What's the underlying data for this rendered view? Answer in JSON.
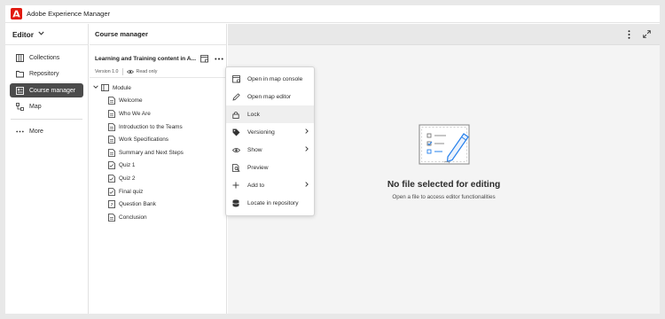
{
  "app": {
    "title": "Adobe Experience Manager"
  },
  "leftnav": {
    "header": "Editor",
    "items": [
      {
        "label": "Collections",
        "icon": "collections-icon"
      },
      {
        "label": "Repository",
        "icon": "repository-icon"
      },
      {
        "label": "Course manager",
        "icon": "course-manager-icon",
        "active": true
      },
      {
        "label": "Map",
        "icon": "map-icon"
      }
    ],
    "more_label": "More"
  },
  "panel": {
    "header": "Course manager",
    "map_title": "Learning and Training content in A...",
    "version": "Version 1.0",
    "read_only": "Read only",
    "root": "Module",
    "children": [
      "Welcome",
      "Who We Are",
      "Introduction to the Teams",
      "Work Specifications",
      "Summary and Next Steps",
      "Quiz 1",
      "Quiz 2",
      "Final quiz",
      "Question Bank",
      "Conclusion"
    ]
  },
  "context_menu": {
    "items": [
      {
        "label": "Open in map console",
        "icon": "map-console-icon"
      },
      {
        "label": "Open map editor",
        "icon": "pencil-icon"
      },
      {
        "label": "Lock",
        "icon": "lock-icon",
        "highlighted": true
      },
      {
        "label": "Versioning",
        "icon": "tag-icon",
        "submenu": true
      },
      {
        "label": "Show",
        "icon": "eye-icon",
        "submenu": true
      },
      {
        "label": "Preview",
        "icon": "preview-icon"
      },
      {
        "label": "Add to",
        "icon": "plus-icon",
        "submenu": true
      },
      {
        "label": "Locate in repository",
        "icon": "database-icon"
      }
    ]
  },
  "main": {
    "empty_title": "No file selected for editing",
    "empty_subtitle": "Open a file to access editor functionalities"
  },
  "colors": {
    "brand": "#e11a10",
    "accent_illustration": "#2680eb",
    "active_nav": "#4b4b4b"
  }
}
